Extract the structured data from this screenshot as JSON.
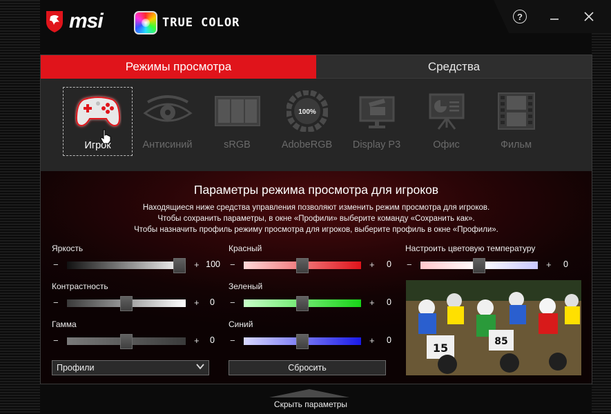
{
  "header": {
    "brand": "msi",
    "product": "TRUE COLOR",
    "help_icon": "question-circle-icon",
    "minimize_icon": "minimize-icon",
    "close_icon": "close-icon"
  },
  "tabs": [
    {
      "label": "Режимы просмотра",
      "active": true
    },
    {
      "label": "Средства",
      "active": false
    }
  ],
  "modes": [
    {
      "label": "Игрок",
      "icon": "gamepad-icon",
      "selected": true
    },
    {
      "label": "Антисиний",
      "icon": "eye-icon",
      "selected": false
    },
    {
      "label": "sRGB",
      "icon": "srgb-panels-icon",
      "selected": false
    },
    {
      "label": "AdobeRGB",
      "icon": "adobergb-dial-icon",
      "selected": false,
      "badge": "100%"
    },
    {
      "label": "Display P3",
      "icon": "movie-monitor-icon",
      "selected": false
    },
    {
      "label": "Офис",
      "icon": "presentation-board-icon",
      "selected": false
    },
    {
      "label": "Фильм",
      "icon": "film-strip-icon",
      "selected": false
    }
  ],
  "params": {
    "title": "Параметры режима просмотра для игроков",
    "desc_line1": "Находящиеся ниже средства управления позволяют изменить режим просмотра для игроков.",
    "desc_line2": "Чтобы сохранить параметры, в окне «Профили» выберите команду «Сохранить как».",
    "desc_line3": "Чтобы назначить профиль режиму просмотра для игроков, выберите профиль в окне «Профили»."
  },
  "controls": {
    "brightness": {
      "label": "Яркость",
      "value": "100",
      "level": 1.0
    },
    "contrast": {
      "label": "Контрастность",
      "value": "0",
      "level": 0.5
    },
    "gamma": {
      "label": "Гамма",
      "value": "0",
      "level": 0.5
    },
    "red": {
      "label": "Красный",
      "value": "0",
      "level": 0.5
    },
    "green": {
      "label": "Зеленый",
      "value": "0",
      "level": 0.5
    },
    "blue": {
      "label": "Синий",
      "value": "0",
      "level": 0.5
    },
    "color_temp": {
      "label": "Настроить цветовую температуру",
      "value": "0",
      "level": 0.5
    },
    "minus": "−",
    "plus": "+"
  },
  "profiles": {
    "label": "Профили"
  },
  "reset": {
    "label": "Сбросить"
  },
  "hide_params": {
    "label": "Скрыть параметры"
  }
}
